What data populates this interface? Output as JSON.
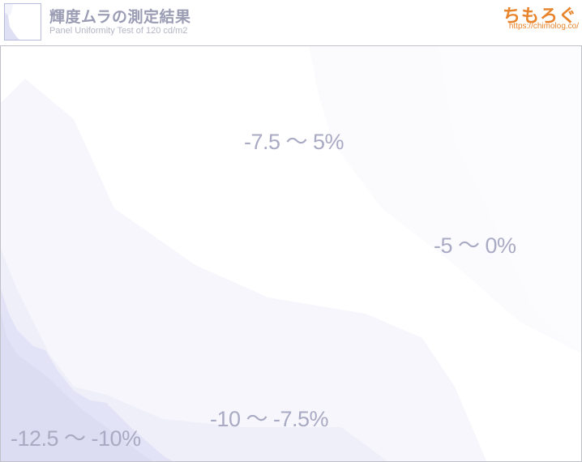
{
  "header": {
    "title": "輝度ムラの測定結果",
    "subtitle": "Panel Uniformity Test of 120 cd/m2",
    "brand": "ちもろぐ",
    "brand_url": "https://chimolog.co/"
  },
  "chart_data": {
    "type": "heatmap",
    "title": "輝度ムラの測定結果",
    "subtitle": "Panel Uniformity Test of 120 cd/m2",
    "zones": [
      {
        "label": "-7.5 〜 5%",
        "range": [
          -7.5,
          -5
        ],
        "color": "#f7f7fc"
      },
      {
        "label": "-5 〜 0%",
        "range": [
          -5,
          0
        ],
        "color": "#ffffff"
      },
      {
        "label": "-10 〜 -7.5%",
        "range": [
          -10,
          -7.5
        ],
        "color": "#ececf8"
      },
      {
        "label": "-12.5 〜 -10%",
        "range": [
          -12.5,
          -10
        ],
        "color": "#e0e1f5"
      }
    ]
  }
}
